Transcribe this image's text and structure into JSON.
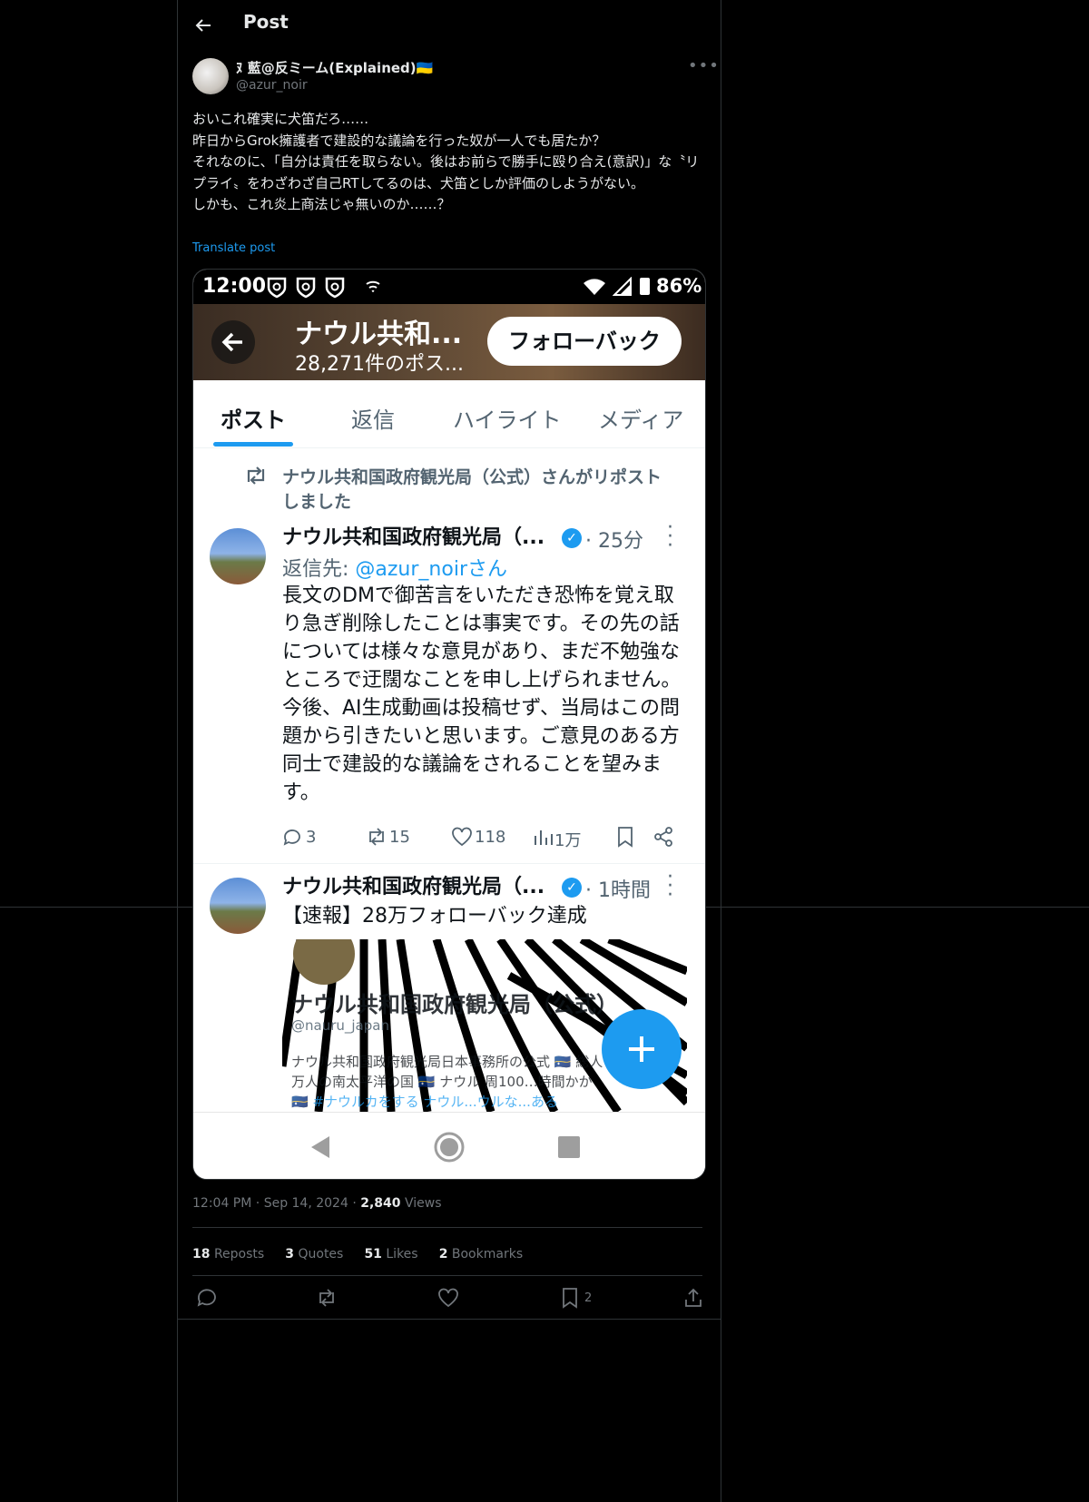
{
  "header": {
    "title": "Post"
  },
  "author": {
    "name": "ﾇ 藍@反ミーム(Explained)🇺🇦",
    "handle": "@azur_noir"
  },
  "post": {
    "text": "おいこれ確実に犬笛だろ……\n昨日からGrok擁護者で建設的な議論を行った奴が一人でも居たか？\nそれなのに、「自分は責任を取らない。後はお前らで勝手に殴り合え(意訳)」な〝リプライ〟をわざわざ自己RTしてるのは、犬笛としか評価のしようがない。\nしかも、これ炎上商法じゃ無いのか……？",
    "translate": "Translate post",
    "time": "12:04 PM",
    "date": "Sep 14, 2024",
    "views_count": "2,840",
    "views_label": "Views"
  },
  "stats": {
    "reposts_count": "18",
    "reposts_label": "Reposts",
    "quotes_count": "3",
    "quotes_label": "Quotes",
    "likes_count": "51",
    "likes_label": "Likes",
    "bookmarks_count": "2",
    "bookmarks_label": "Bookmarks"
  },
  "actions": {
    "bookmark_count": "2"
  },
  "screenshot": {
    "statusbar": {
      "time": "12:00",
      "battery": "86%"
    },
    "profile_header": {
      "name": "ナウル共和...",
      "posts_count": "28,271件のポス...",
      "follow_back_label": "フォローバック"
    },
    "tabs": [
      "ポスト",
      "返信",
      "ハイライト",
      "メディア"
    ],
    "repost_note": "ナウル共和国政府観光局（公式）さんがリポスト\nしました",
    "tweet1": {
      "name": "ナウル共和国政府観光局（...",
      "time": "· 25分",
      "reply_prefix": "返信先: ",
      "reply_to": "@azur_noirさん",
      "text": "長文のDMで御苦言をいただき恐怖を覚え取り急ぎ削除したことは事実です。その先の話については様々な意見があり、まだ不勉強なところで迂闊なことを申し上げられません。今後、AI生成動画は投稿せず、当局はこの問題から引きたいと思います。ご意見のある方同士で建設的な議論をされることを望みます。",
      "replies": "3",
      "reposts": "15",
      "likes": "118",
      "views": "1万"
    },
    "tweet2": {
      "name": "ナウル共和国政府観光局（...",
      "time": "· 1時間",
      "text": "【速報】28万フォローバック達成",
      "image_title": "ナウル共和国政府観光局（公式）",
      "image_handle": "@nauru_japan",
      "image_line1": "ナウル共和国政府観光局日本事務所の公式 🇳🇷 総人",
      "image_line2": "万人の南太平洋の国 🇳🇷 ナウル 周100…時間かか",
      "image_line3": "🇳🇷 #ナウルカをする ナウル...ウルな...ある"
    }
  }
}
